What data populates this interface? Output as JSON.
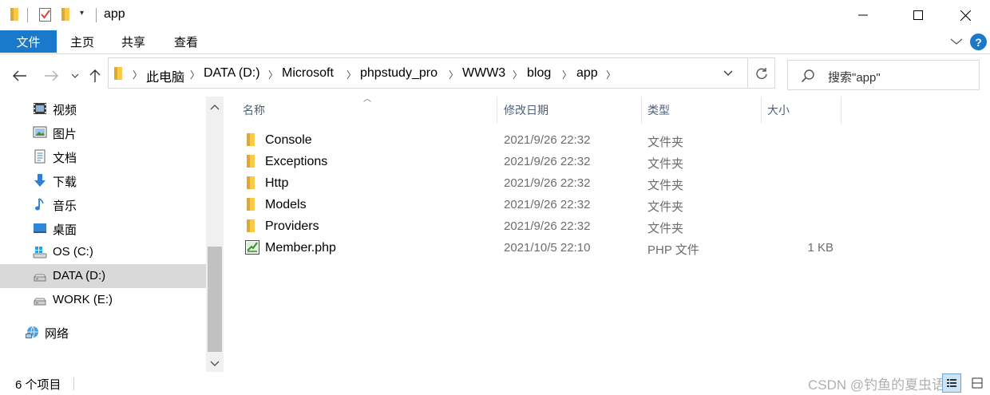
{
  "window": {
    "title": "app"
  },
  "ribbon": {
    "file": "文件",
    "tabs": [
      "主页",
      "共享",
      "查看"
    ],
    "help": "?"
  },
  "address": {
    "crumbs": [
      "此电脑",
      "DATA (D:)",
      "Microsoft",
      "phpstudy_pro",
      "WWW3",
      "blog",
      "app"
    ]
  },
  "search": {
    "placeholder": "搜索\"app\""
  },
  "navpane": {
    "items": [
      {
        "label": "视频",
        "icon": "video-icon"
      },
      {
        "label": "图片",
        "icon": "pictures-icon"
      },
      {
        "label": "文档",
        "icon": "documents-icon"
      },
      {
        "label": "下载",
        "icon": "downloads-icon"
      },
      {
        "label": "音乐",
        "icon": "music-icon"
      },
      {
        "label": "桌面",
        "icon": "desktop-icon"
      },
      {
        "label": "OS (C:)",
        "icon": "windows-drive-icon"
      },
      {
        "label": "DATA (D:)",
        "icon": "drive-icon",
        "selected": true
      },
      {
        "label": "WORK (E:)",
        "icon": "drive-icon"
      },
      {
        "label": "网络",
        "icon": "network-icon"
      }
    ]
  },
  "columns": {
    "name": "名称",
    "date": "修改日期",
    "type": "类型",
    "size": "大小"
  },
  "files": [
    {
      "name": "Console",
      "date": "2021/9/26 22:32",
      "type": "文件夹",
      "size": "",
      "kind": "folder"
    },
    {
      "name": "Exceptions",
      "date": "2021/9/26 22:32",
      "type": "文件夹",
      "size": "",
      "kind": "folder"
    },
    {
      "name": "Http",
      "date": "2021/9/26 22:32",
      "type": "文件夹",
      "size": "",
      "kind": "folder"
    },
    {
      "name": "Models",
      "date": "2021/9/26 22:32",
      "type": "文件夹",
      "size": "",
      "kind": "folder"
    },
    {
      "name": "Providers",
      "date": "2021/9/26 22:32",
      "type": "文件夹",
      "size": "",
      "kind": "folder"
    },
    {
      "name": "Member.php",
      "date": "2021/10/5 22:10",
      "type": "PHP 文件",
      "size": "1 KB",
      "kind": "php"
    }
  ],
  "status": {
    "count": "6 个项目",
    "watermark": "CSDN @钓鱼的夏虫语冰"
  },
  "colors": {
    "accent": "#1979ca",
    "folder": "#f8c94b",
    "selected_nav": "#d9d9d9"
  }
}
